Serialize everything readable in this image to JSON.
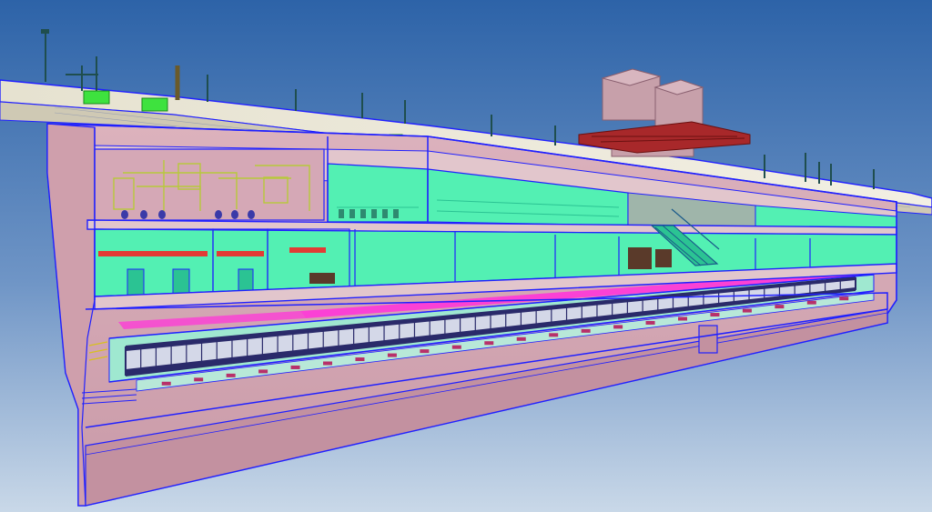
{
  "scene": {
    "kind": "bim-3d-section-view",
    "subject": "underground-station",
    "colors": {
      "sky_top": "#2d63a8",
      "sky_bottom": "#c9d8e8",
      "concrete": "#d7a9b5",
      "concrete_dark": "#b98d9c",
      "edge": "#2020ff",
      "room_fill": "#53f0b3",
      "room_dark": "#2bc393",
      "ceiling_service": "#e8e4d2",
      "duct_pink": "#ff36d8",
      "duct_red": "#e23b35",
      "pipe_yellow": "#cdd04a",
      "train_track": "#2a2a6a",
      "tower": "#c7a0aa",
      "canopy": "#a8282a",
      "pole": "#1f4e4e",
      "sign_green": "#3ee23e"
    },
    "icons": {
      "poles": "lamp-pole-icon",
      "signs": "green-sign-icon",
      "escalator": "escalator-icon"
    }
  }
}
